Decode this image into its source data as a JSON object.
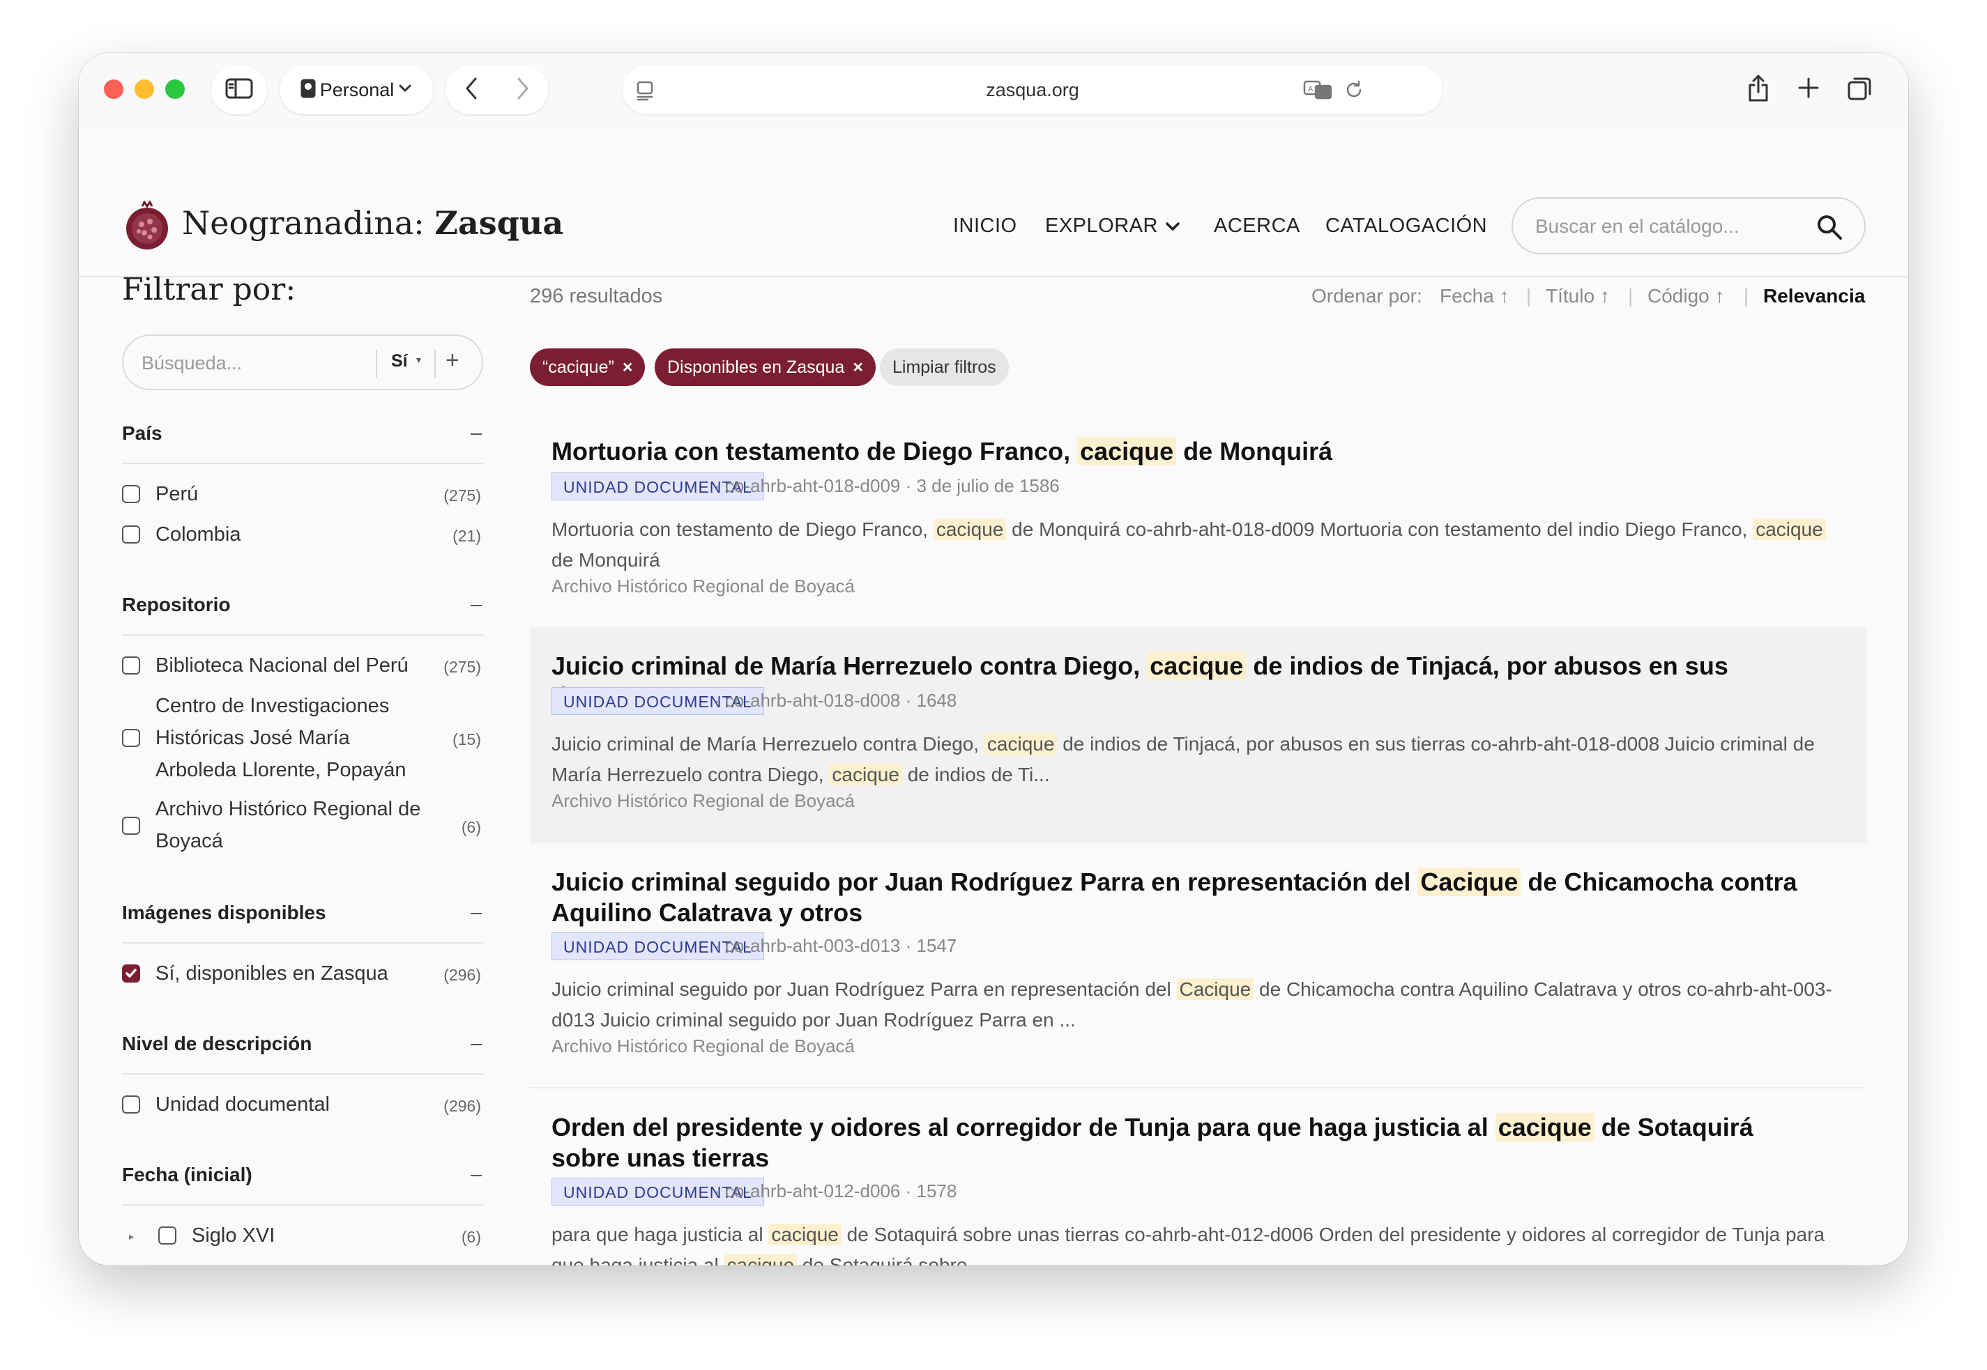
{
  "browser": {
    "profile": "Personal",
    "url": "zasqua.org"
  },
  "site": {
    "title_plain": "Neogranadina: ",
    "title_bold": "Zasqua",
    "nav": [
      "INICIO",
      "EXPLORAR",
      "ACERCA",
      "CATALOGACIÓN"
    ],
    "search_placeholder": "Buscar en el catálogo..."
  },
  "sidebar": {
    "title": "Filtrar por:",
    "search_placeholder": "Búsqueda...",
    "search_mode": "Sí",
    "search_add": "+",
    "sections": [
      {
        "title": "País",
        "options": [
          {
            "label": "Perú",
            "count": "(275)",
            "checked": false
          },
          {
            "label": "Colombia",
            "count": "(21)",
            "checked": false
          }
        ]
      },
      {
        "title": "Repositorio",
        "options": [
          {
            "label": "Biblioteca Nacional del Perú",
            "count": "(275)",
            "checked": false
          },
          {
            "label": "Centro de Investigaciones Históricas José María Arboleda Llorente, Popayán",
            "count": "(15)",
            "checked": false
          },
          {
            "label": "Archivo Histórico Regional de Boyacá",
            "count": "(6)",
            "checked": false
          }
        ]
      },
      {
        "title": "Imágenes disponibles",
        "options": [
          {
            "label": "Sí, disponibles en Zasqua",
            "count": "(296)",
            "checked": true
          }
        ]
      },
      {
        "title": "Nivel de descripción",
        "options": [
          {
            "label": "Unidad documental",
            "count": "(296)",
            "checked": false
          }
        ]
      },
      {
        "title": "Fecha (inicial)",
        "options": [
          {
            "label": "Siglo XVI",
            "count": "(6)",
            "checked": false
          }
        ]
      }
    ]
  },
  "results": {
    "count_text": "296 resultados",
    "sort_label": "Ordenar por:",
    "sort_options": [
      "Fecha",
      "Título",
      "Código",
      "Relevancia"
    ],
    "sort_active": "Relevancia",
    "chips": [
      "“cacique”",
      "Disponibles en Zasqua",
      "Limpiar filtros"
    ],
    "chip_close": "×",
    "items": [
      {
        "title": [
          "Mortuoria con testamento de Diego Franco, ",
          "cacique",
          " de Monquirá"
        ],
        "badge": "UNIDAD DOCUMENTAL",
        "meta": "· co-ahrb-aht-018-d009 · 3 de julio de 1586",
        "snippet": [
          "Mortuoria con testamento de Diego Franco, ",
          "cacique",
          " de Monquirá co-ahrb-aht-018-d009 Mortuoria con testamento del indio Diego Franco, ",
          "cacique",
          " de Monquirá"
        ],
        "repository": "Archivo Histórico Regional de Boyacá"
      },
      {
        "title": [
          "Juicio criminal de María Herrezuelo contra Diego, ",
          "cacique",
          " de indios de Tinjacá, por abusos en sus tierras"
        ],
        "badge": "UNIDAD DOCUMENTAL",
        "meta": "· co-ahrb-aht-018-d008 · 1648",
        "snippet": [
          "Juicio criminal de María Herrezuelo contra Diego, ",
          "cacique",
          " de indios de Tinjacá, por abusos en sus tierras co-ahrb-aht-018-d008 Juicio criminal de María Herrezuelo contra Diego, ",
          "cacique",
          " de indios de Ti..."
        ],
        "repository": "Archivo Histórico Regional de Boyacá"
      },
      {
        "title": [
          "Juicio criminal seguido por Juan Rodríguez Parra en representación del ",
          "Cacique",
          " de Chicamocha contra Aquilino Calatrava y otros"
        ],
        "badge": "UNIDAD DOCUMENTAL",
        "meta": "· co-ahrb-aht-003-d013 · 1547",
        "snippet": [
          "Juicio criminal seguido por Juan Rodríguez Parra en representación del ",
          "Cacique",
          " de Chicamocha contra Aquilino Calatrava y otros co-ahrb-aht-003-d013 Juicio criminal seguido por Juan Rodríguez Parra en ..."
        ],
        "repository": "Archivo Histórico Regional de Boyacá"
      },
      {
        "title": [
          "Orden del presidente y oidores al corregidor de Tunja para que haga justicia al ",
          "cacique",
          " de Sotaquirá sobre unas tierras"
        ],
        "badge": "UNIDAD DOCUMENTAL",
        "meta": "· co-ahrb-aht-012-d006 · 1578",
        "snippet": [
          "para que haga justicia al ",
          "cacique",
          " de Sotaquirá sobre unas tierras co-ahrb-aht-012-d006 Orden del presidente y oidores al corregidor de Tunja para que haga justicia al ",
          "cacique",
          " de Sotaquirá sobre"
        ],
        "repository": ""
      }
    ]
  },
  "colors": {
    "accent": "#7b1e31",
    "highlight": "#fdf0cf",
    "badge_bg": "#e3e6fb"
  }
}
